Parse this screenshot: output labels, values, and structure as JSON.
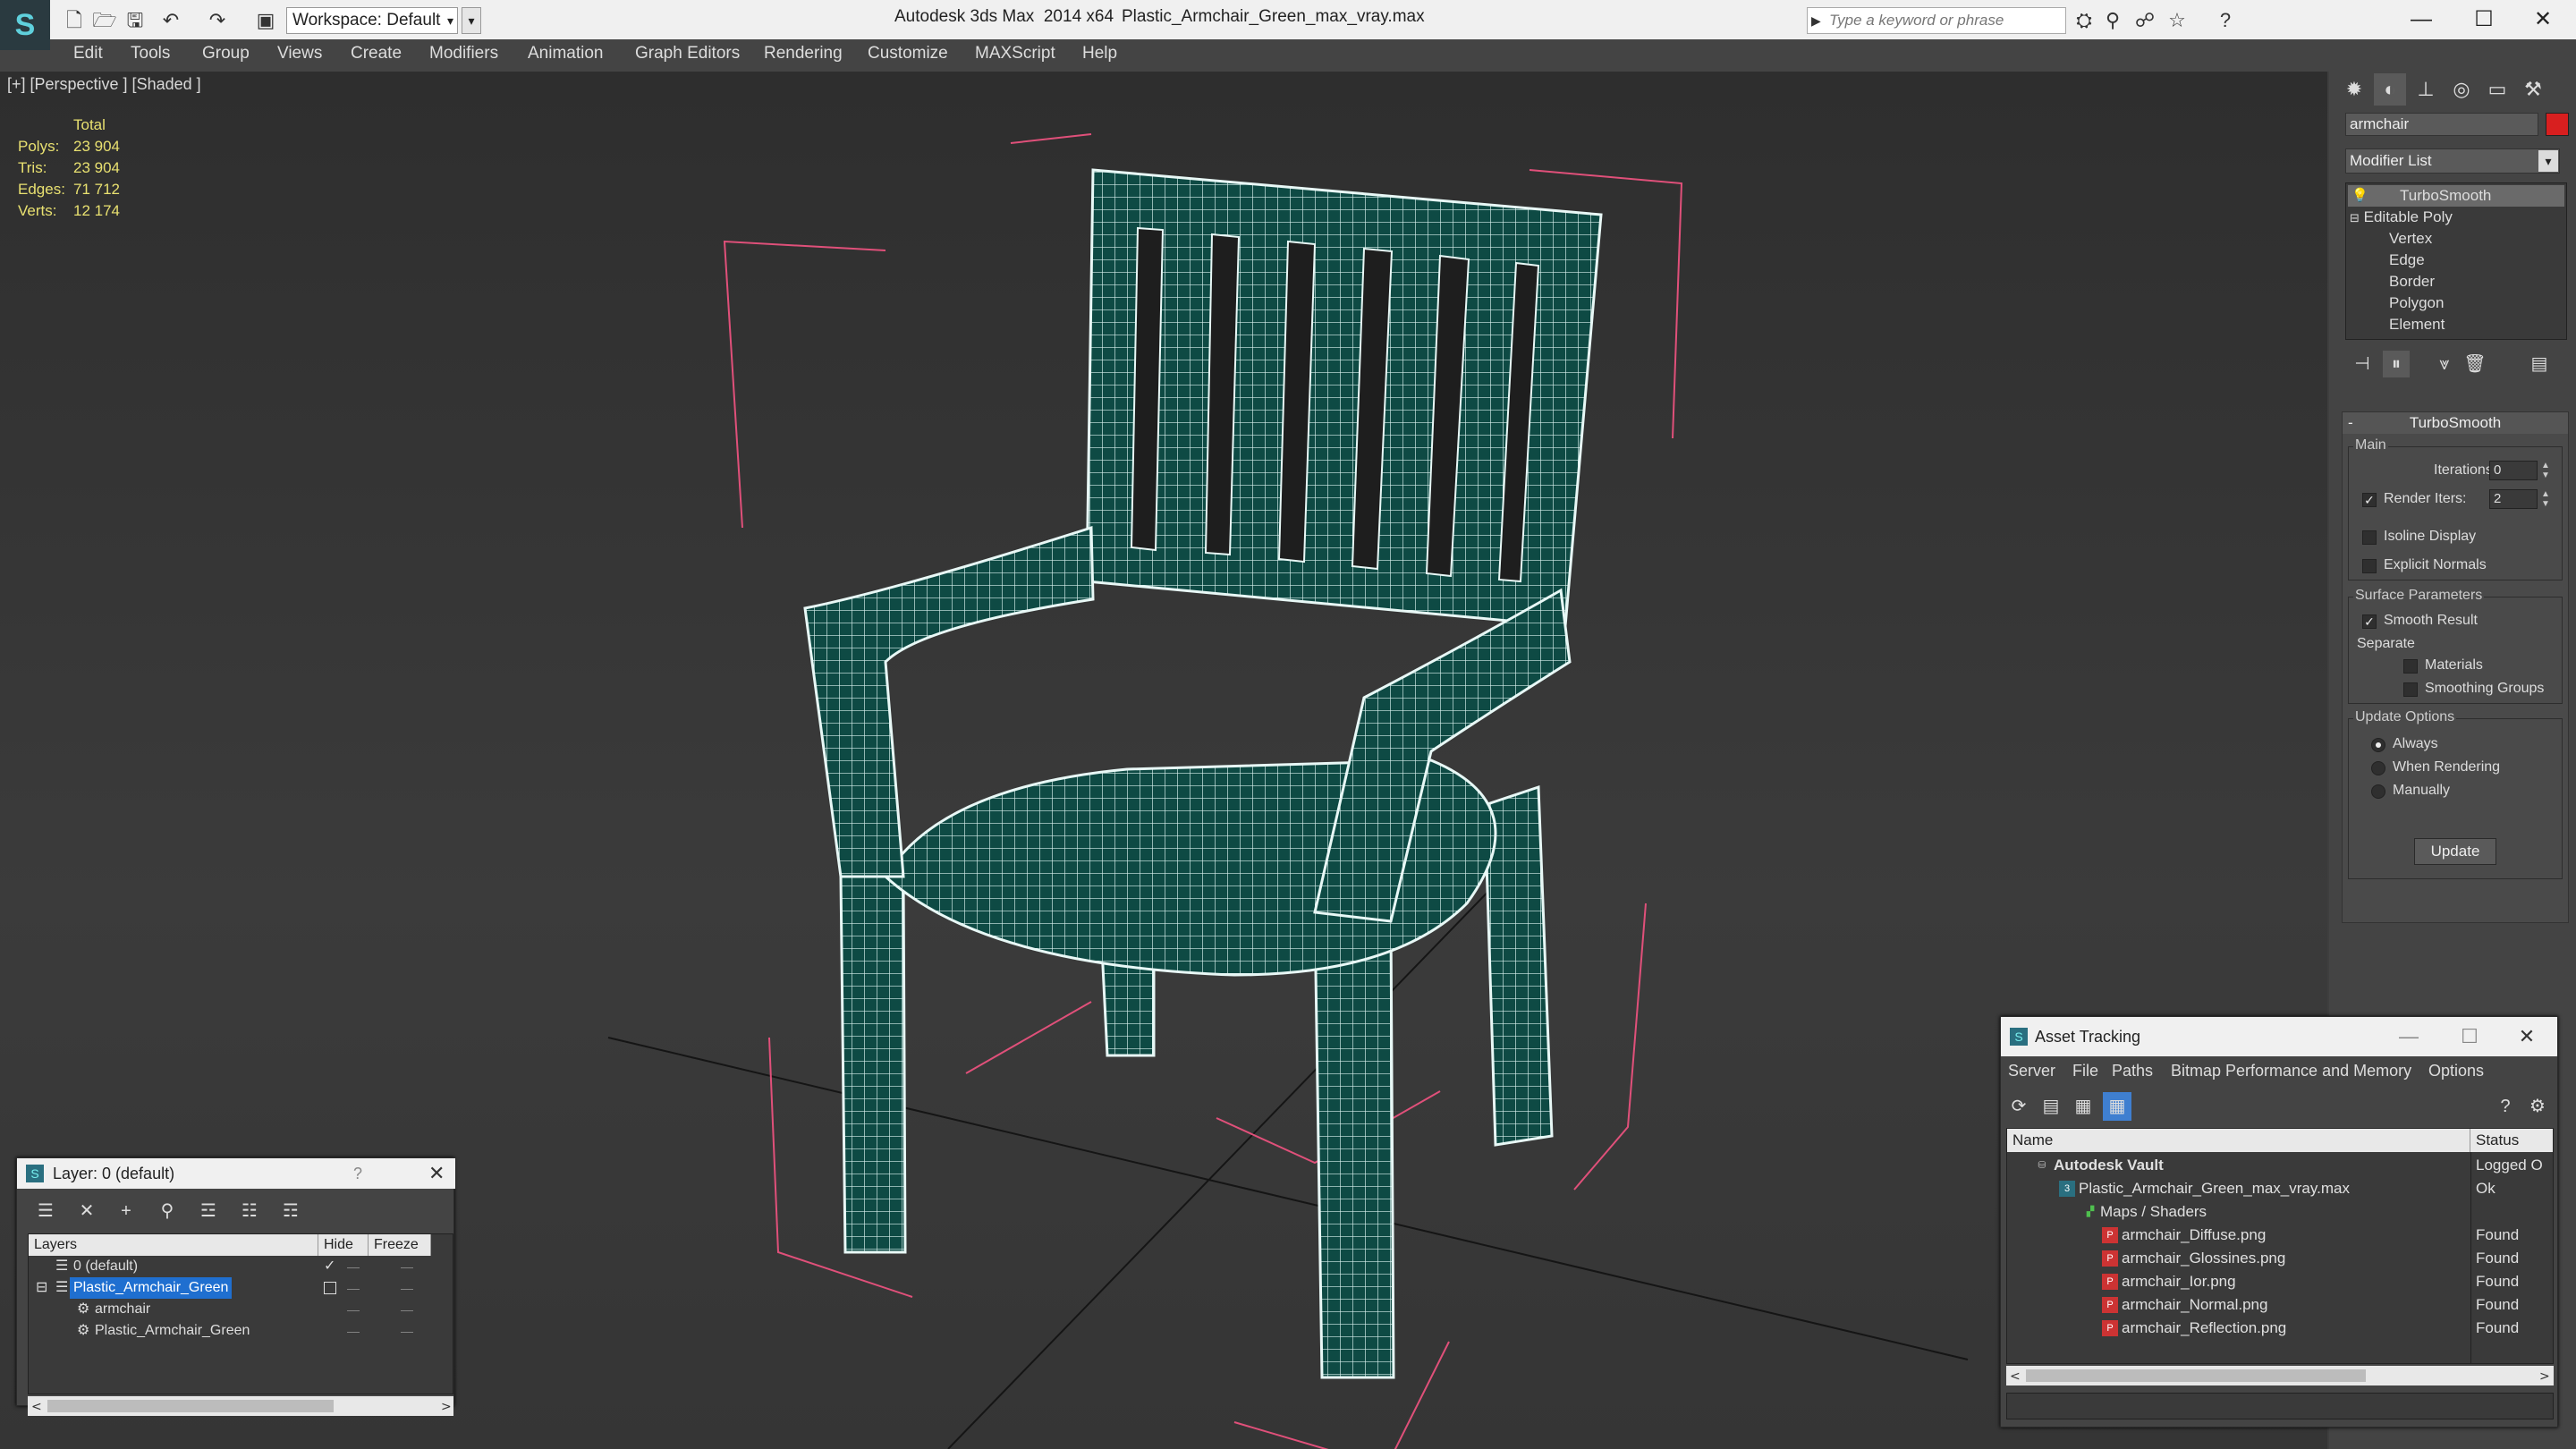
{
  "titlebar": {
    "workspace": "Workspace: Default",
    "app_title": "Autodesk 3ds Max  2014 x64",
    "file_name": "Plastic_Armchair_Green_max_vray.max",
    "search_placeholder": "Type a keyword or phrase",
    "controls": [
      "—",
      "☐",
      "✕"
    ]
  },
  "menu": [
    "Edit",
    "Tools",
    "Group",
    "Views",
    "Create",
    "Modifiers",
    "Animation",
    "Graph Editors",
    "Rendering",
    "Customize",
    "MAXScript",
    "Help"
  ],
  "viewport": {
    "label": "[+] [Perspective ] [Shaded ]",
    "stats": {
      "header": "Total",
      "rows": [
        {
          "label": "Polys:",
          "value": "23 904"
        },
        {
          "label": "Tris:",
          "value": "23 904"
        },
        {
          "label": "Edges:",
          "value": "71 712"
        },
        {
          "label": "Verts:",
          "value": "12 174"
        }
      ]
    }
  },
  "command_panel": {
    "object_name": "armchair",
    "object_color": "#d81f1f",
    "modifier_list": "Modifier List",
    "stack": {
      "top": "TurboSmooth",
      "base": "Editable Poly",
      "subobjects": [
        "Vertex",
        "Edge",
        "Border",
        "Polygon",
        "Element"
      ]
    },
    "rollout": {
      "title": "TurboSmooth",
      "main_group": "Main",
      "iterations_label": "Iterations:",
      "iterations_value": "0",
      "render_iters_label": "Render Iters:",
      "render_iters_value": "2",
      "render_iters_checked": true,
      "isoline_label": "Isoline Display",
      "explicit_label": "Explicit Normals",
      "surface_group": "Surface Parameters",
      "smooth_result": "Smooth Result",
      "separate": "Separate",
      "materials": "Materials",
      "smoothing_groups": "Smoothing Groups",
      "update_group": "Update Options",
      "always": "Always",
      "when_rendering": "When Rendering",
      "manually": "Manually",
      "update_btn": "Update"
    }
  },
  "layer_window": {
    "title": "Layer: 0 (default)",
    "help": "?",
    "close": "✕",
    "headers": {
      "layers": "Layers",
      "hide": "Hide",
      "freeze": "Freeze"
    },
    "rows": [
      {
        "name": "0 (default)"
      },
      {
        "name": "Plastic_Armchair_Green"
      },
      {
        "name": "armchair"
      },
      {
        "name": "Plastic_Armchair_Green"
      }
    ]
  },
  "asset_window": {
    "title": "Asset Tracking",
    "menu": [
      "Server",
      "File",
      "Paths",
      "Bitmap Performance and Memory",
      "Options"
    ],
    "headers": {
      "name": "Name",
      "status": "Status"
    },
    "rows": [
      {
        "name": "Autodesk Vault",
        "status": "Logged O"
      },
      {
        "name": "Plastic_Armchair_Green_max_vray.max",
        "status": "Ok"
      },
      {
        "name": "Maps / Shaders",
        "status": ""
      },
      {
        "name": "armchair_Diffuse.png",
        "status": "Found"
      },
      {
        "name": "armchair_Glossines.png",
        "status": "Found"
      },
      {
        "name": "armchair_Ior.png",
        "status": "Found"
      },
      {
        "name": "armchair_Normal.png",
        "status": "Found"
      },
      {
        "name": "armchair_Reflection.png",
        "status": "Found"
      }
    ]
  }
}
